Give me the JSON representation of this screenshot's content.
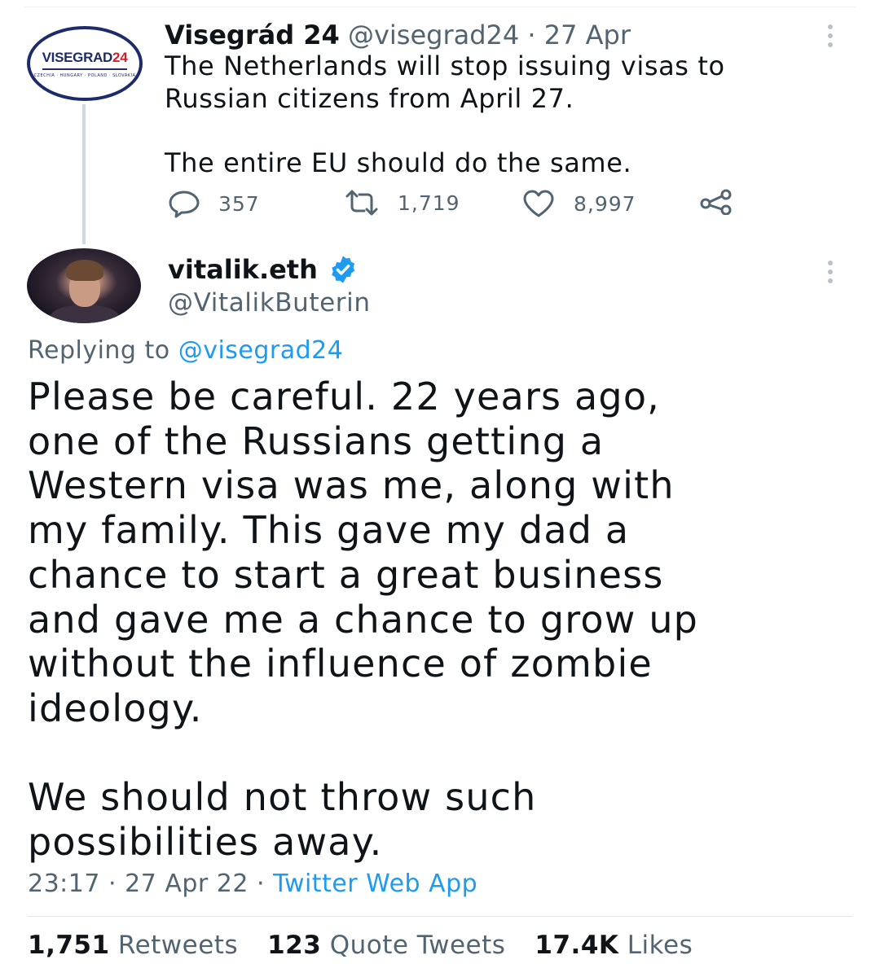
{
  "parent_tweet": {
    "avatar_logo": {
      "main": "VISEGRAD",
      "accent": "24",
      "sub": "CZECHIA · HUNGARY · POLAND · SLOVAKIA"
    },
    "name": "Visegrád 24",
    "handle": "@visegrad24",
    "separator": "·",
    "date": "27 Apr",
    "text": "The Netherlands will stop issuing visas to\nRussian citizens from April 27.\n\nThe entire EU should do the same.",
    "replies": "357",
    "retweets": "1,719",
    "likes": "8,997"
  },
  "reply_tweet": {
    "name": "vitalik.eth",
    "handle": "@VitalikButerin",
    "replying_prefix": "Replying to",
    "replying_to": "@visegrad24",
    "text": "Please be careful. 22 years ago,\none of the Russians getting a\nWestern visa was me, along with\nmy family. This gave my dad a\nchance to start a great business\nand gave me a chance to grow up\nwithout the influence of zombie\nideology.\n\nWe should not throw such\npossibilities away.",
    "time": "23:17",
    "separator": "·",
    "date": "27 Apr 22",
    "source": "Twitter Web App",
    "stats": {
      "retweets_count": "1,751",
      "retweets_label": "Retweets",
      "quotes_count": "123",
      "quotes_label": "Quote Tweets",
      "likes_count": "17.4K",
      "likes_label": "Likes"
    }
  },
  "colors": {
    "link": "#1d9bf0",
    "muted": "#536471",
    "verified": "#1d9bf0",
    "logo_navy": "#1d2b6b",
    "logo_red": "#d3202a"
  },
  "icons": [
    "reply-icon",
    "retweet-icon",
    "like-icon",
    "share-icon",
    "more-icon",
    "verified-badge-icon"
  ]
}
